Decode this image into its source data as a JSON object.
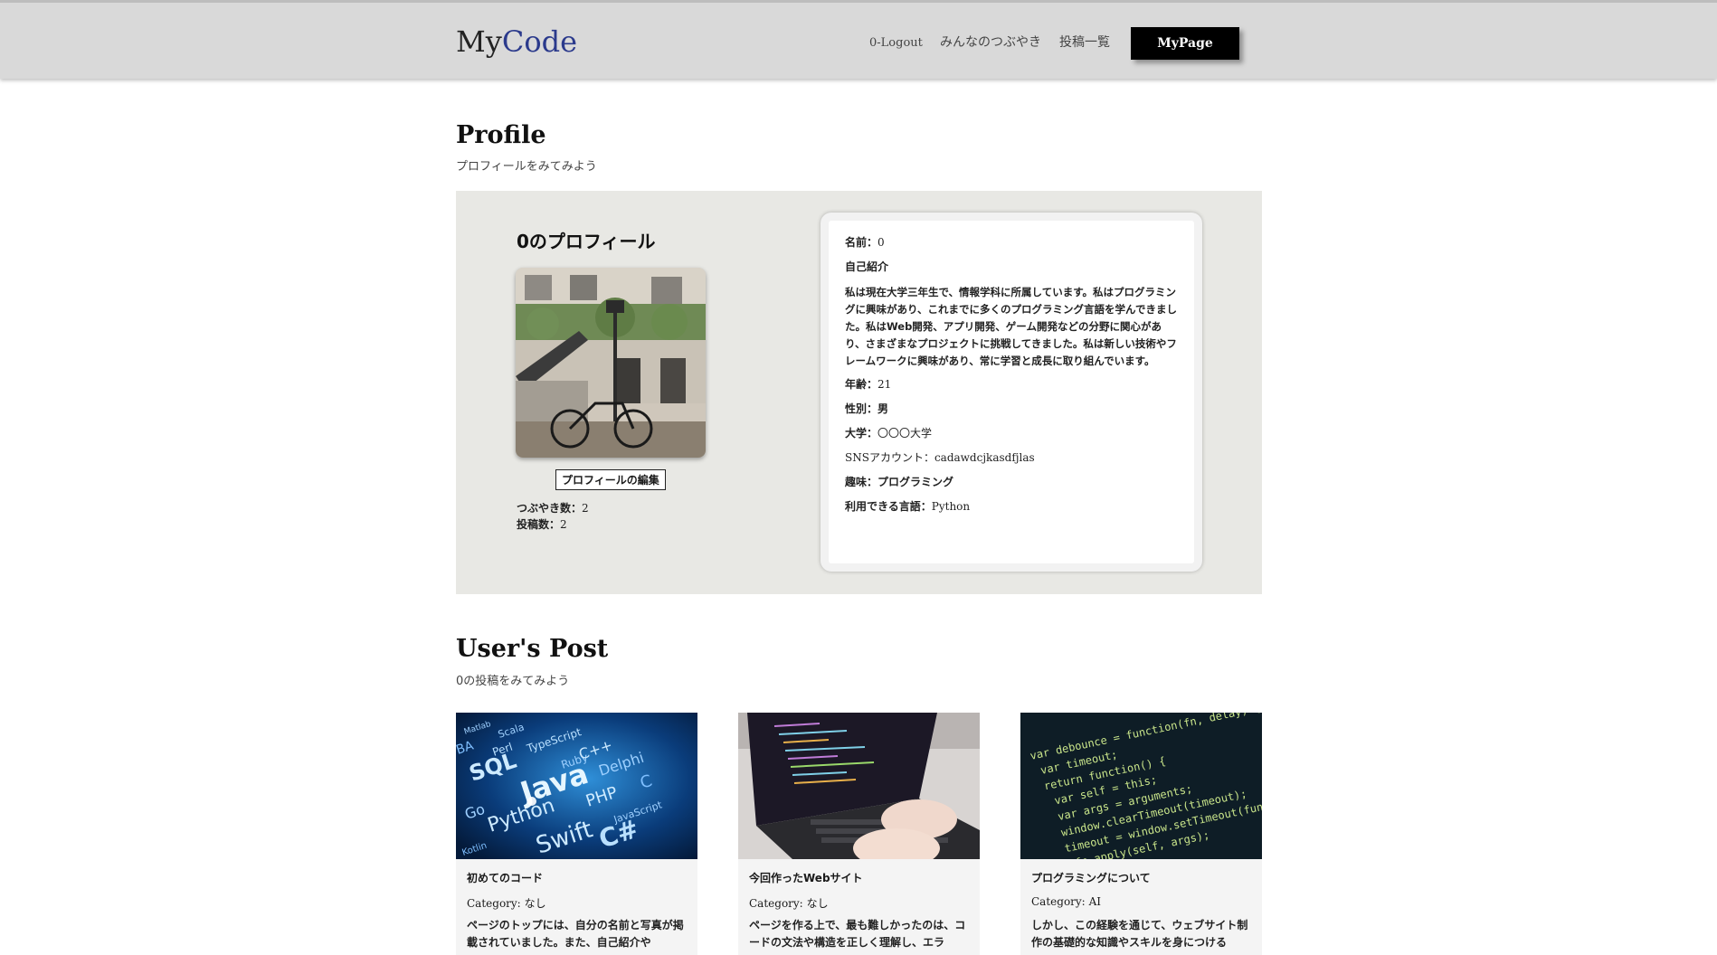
{
  "header": {
    "logo_my": "My",
    "logo_code": "Code",
    "nav": {
      "logout": "0-Logout",
      "tweets": "みんなのつぶやき",
      "posts": "投稿一覧",
      "mypage": "MyPage"
    }
  },
  "profile_section": {
    "title": "Profile",
    "subtitle": "プロフィールをみてみよう",
    "heading": "0のプロフィール",
    "edit_button": "プロフィールの編集",
    "tweet_count_label": "つぶやき数：",
    "tweet_count": "2",
    "post_count_label": "投稿数：",
    "post_count": "2"
  },
  "info": {
    "name_label": "名前：",
    "name": "0",
    "intro_label": "自己紹介",
    "intro": "私は現在大学三年生で、情報学科に所属しています。私はプログラミングに興味があり、これまでに多くのプログラミング言語を学んできました。私はWeb開発、アプリ開発、ゲーム開発などの分野に関心があり、さまざまなプロジェクトに挑戦してきました。私は新しい技術やフレームワークに興味があり、常に学習と成長に取り組んでいます。",
    "age_label": "年齢：",
    "age": "21",
    "gender_label": "性別：",
    "gender": "男",
    "university_label": "大学：",
    "university": "〇〇〇大学",
    "sns_label": "SNSアカウント：",
    "sns": "cadawdcjkasdfjlas",
    "hobby_label": "趣味：",
    "hobby": "プログラミング",
    "languages_label": "利用できる言語：",
    "languages": "Python"
  },
  "posts_section": {
    "title": "User's Post",
    "subtitle": "0の投稿をみてみよう",
    "category_label": "Category:",
    "posts": [
      {
        "title": "初めてのコード",
        "category": "なし",
        "body": "ページのトップには、自分の名前と写真が掲載されていました。また、自己紹介や",
        "image_words": [
          "Matlab",
          "Scala",
          "Perl",
          "TypeScript",
          "SQL",
          "Java",
          "Ruby",
          "C++",
          "Delphi",
          "Go",
          "Python",
          "PHP",
          "JavaScript",
          "Swift",
          "C#",
          "Kotlin",
          "BA",
          "C"
        ]
      },
      {
        "title": "今回作ったWebサイト",
        "category": "なし",
        "body": "ページを作る上で、最も難しかったのは、コードの文法や構造を正しく理解し、エラ"
      },
      {
        "title": "プログラミングについて",
        "category": "AI",
        "body": "しかし、この経験を通じて、ウェブサイト制作の基礎的な知識やスキルを身につける",
        "image_code": [
          "var debounce = function(fn, delay) {",
          "  var timeout;",
          "  return function() {",
          "    var self = this;",
          "    var args = arguments;",
          "    window.clearTimeout(timeout);",
          "    timeout = window.setTimeout(function",
          "      fn.apply(self, args);"
        ]
      }
    ]
  },
  "colors": {
    "header_bg": "#d9d9d9",
    "logo_accent": "#2b3a8c",
    "panel_bg": "#e8e8e4",
    "button_bg": "#000000"
  }
}
